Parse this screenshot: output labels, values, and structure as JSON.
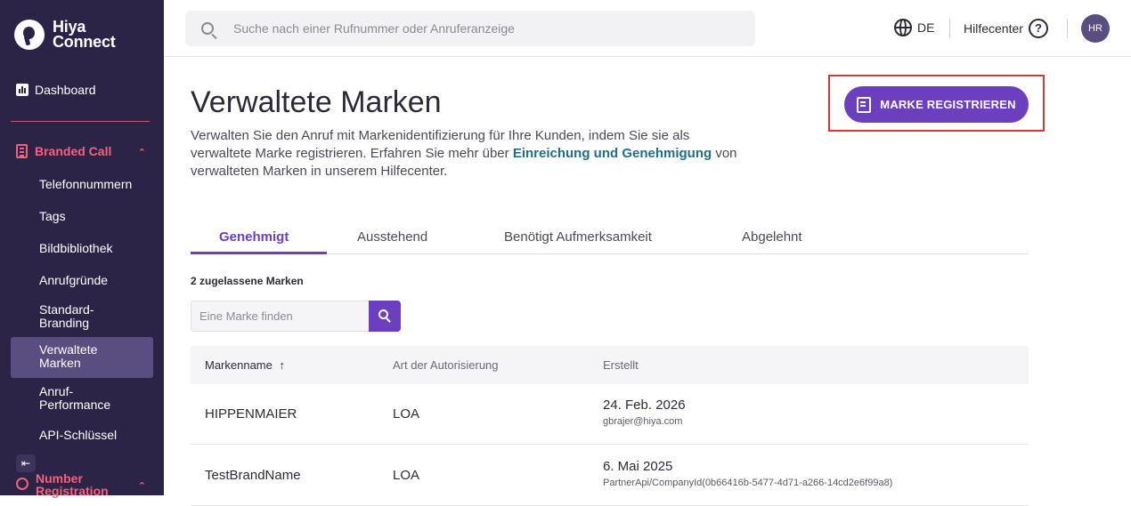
{
  "brand": {
    "name_line1": "Hiya",
    "name_line2": "Connect"
  },
  "sidebar": {
    "dashboard": "Dashboard",
    "group_branded": "Branded Call",
    "items": [
      {
        "label": "Telefonnummern"
      },
      {
        "label": "Tags"
      },
      {
        "label": "Bildbibliothek"
      },
      {
        "label": "Anrufgründe"
      },
      {
        "label": "Standard-Branding"
      },
      {
        "label": "Verwaltete Marken",
        "active": true
      },
      {
        "label": "Anruf-Performance"
      },
      {
        "label": "API-Schlüssel"
      }
    ],
    "group_number": "Number Registration"
  },
  "topbar": {
    "search_placeholder": "Suche nach einer Rufnummer oder Anruferanzeige",
    "language": "DE",
    "help": "Hilfecenter",
    "avatar_initials": "HR"
  },
  "page": {
    "title": "Verwaltete Marken",
    "desc_part1": "Verwalten Sie den Anruf mit Markenidentifizierung für Ihre Kunden, indem Sie sie als verwaltete Marke registrieren. Erfahren Sie mehr über ",
    "desc_link": "Einreichung und Genehmigung",
    "desc_part2": " von verwalteten Marken in unserem Hilfecenter.",
    "register_button": "MARKE REGISTRIEREN"
  },
  "tabs": [
    {
      "label": "Genehmigt",
      "active": true
    },
    {
      "label": "Ausstehend"
    },
    {
      "label": "Benötigt Aufmerksamkeit"
    },
    {
      "label": "Abgelehnt"
    }
  ],
  "list": {
    "count_text": "2 zugelassene Marken",
    "find_placeholder": "Eine Marke finden",
    "columns": [
      "Markenname",
      "Art der Autorisierung",
      "Erstellt"
    ],
    "sort_indicator": "↑",
    "rows": [
      {
        "name": "HIPPENMAIER",
        "auth": "LOA",
        "created": "24. Feb. 2026",
        "creator": "gbrajer@hiya.com"
      },
      {
        "name": "TestBrandName",
        "auth": "LOA",
        "created": "6. Mai 2025",
        "creator": "PartnerApi/CompanyId(0b66416b-5477-4d71-a266-14cd2e6f99a8)"
      }
    ]
  },
  "colors": {
    "sidebar_bg": "#2c2447",
    "accent": "#6b3fbe",
    "sidebar_accent": "#f0637d",
    "link": "#1f6f8b",
    "highlight_box": "#d03a3a"
  },
  "icons": [
    "hiya-logo-icon",
    "dashboard-icon",
    "branded-call-icon",
    "chevron-up-icon",
    "collapse-icon",
    "number-registration-icon",
    "search-icon",
    "globe-icon",
    "help-icon",
    "register-brand-icon",
    "sort-arrow-icon"
  ]
}
